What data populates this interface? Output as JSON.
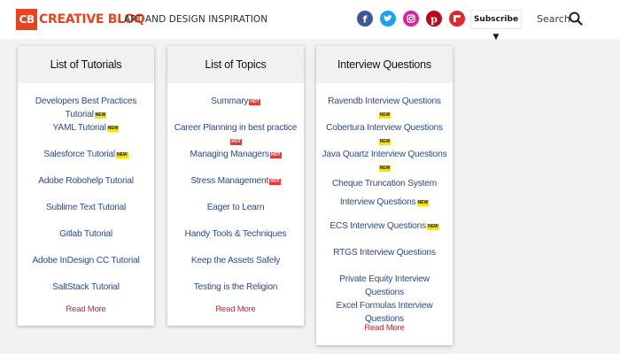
{
  "header": {
    "logo_badge": "CB",
    "logo_name": "CREATIVE BLOQ",
    "tagline": "ART AND DESIGN INSPIRATION",
    "socials": [
      {
        "name": "facebook",
        "glyph": "f",
        "color": "#3b5998"
      },
      {
        "name": "twitter",
        "glyph": "t",
        "color": "#1da1f2"
      },
      {
        "name": "instagram",
        "glyph": "◎",
        "color": "#d6249f"
      },
      {
        "name": "pinterest",
        "glyph": "p",
        "color": "#bd081c"
      },
      {
        "name": "flipboard",
        "glyph": "f",
        "color": "#e12828"
      }
    ],
    "subscribe_label": "Subscribe ▼",
    "search_label": "Search"
  },
  "cards": [
    {
      "title": "List of Tutorials",
      "items": [
        {
          "text": "Developers Best Practices Tutorial",
          "badge": "NEW"
        },
        {
          "text": "YAML Tutorial",
          "badge": "NEW"
        },
        {
          "text": "Salesforce Tutorial",
          "badge": "NEW"
        },
        {
          "text": "Adobe Robohelp Tutorial",
          "badge": ""
        },
        {
          "text": "Sublime Text Tutorial",
          "badge": ""
        },
        {
          "text": "Gitlab Tutorial",
          "badge": ""
        },
        {
          "text": "Adobe InDesign CC Tutorial",
          "badge": ""
        },
        {
          "text": "SaltStack Tutorial",
          "badge": ""
        }
      ],
      "read_more": "Read More"
    },
    {
      "title": "List of Topics",
      "items": [
        {
          "text": "Summary",
          "badge": "HOT"
        },
        {
          "text": "Career Planning in best practice",
          "badge": "HOT"
        },
        {
          "text": "Managing Managers",
          "badge": "HOT"
        },
        {
          "text": "Stress Management",
          "badge": "HOT"
        },
        {
          "text": "Eager to Learn",
          "badge": ""
        },
        {
          "text": "Handy Tools & Techniques",
          "badge": ""
        },
        {
          "text": "Keep the Assets Safely",
          "badge": ""
        },
        {
          "text": "Testing is the Religion",
          "badge": ""
        }
      ],
      "read_more": "Read More"
    },
    {
      "title": "Interview Questions",
      "items": [
        {
          "text": "Ravendb Interview Questions",
          "badge": "NEW"
        },
        {
          "text": "Cobertura Interview Questions",
          "badge": "NEW"
        },
        {
          "text": "Java Quartz Interview Questions",
          "badge": "NEW"
        },
        {
          "text": "Cheque Truncation System Interview Questions",
          "badge": "NEW"
        },
        {
          "text": "ECS Interview Questions",
          "badge": "NEW"
        },
        {
          "text": "RTGS Interview Questions",
          "badge": ""
        },
        {
          "text": "Private Equity Interview Questions",
          "badge": ""
        },
        {
          "text": "Excel Formulas Interview Questions",
          "badge": ""
        }
      ],
      "read_more": "Read More"
    }
  ],
  "colors": {
    "brand": "#e8431f",
    "link": "#2c4a8c",
    "read_more": "#c62828",
    "badge_new": "#f7e300",
    "badge_hot": "#e53935"
  }
}
